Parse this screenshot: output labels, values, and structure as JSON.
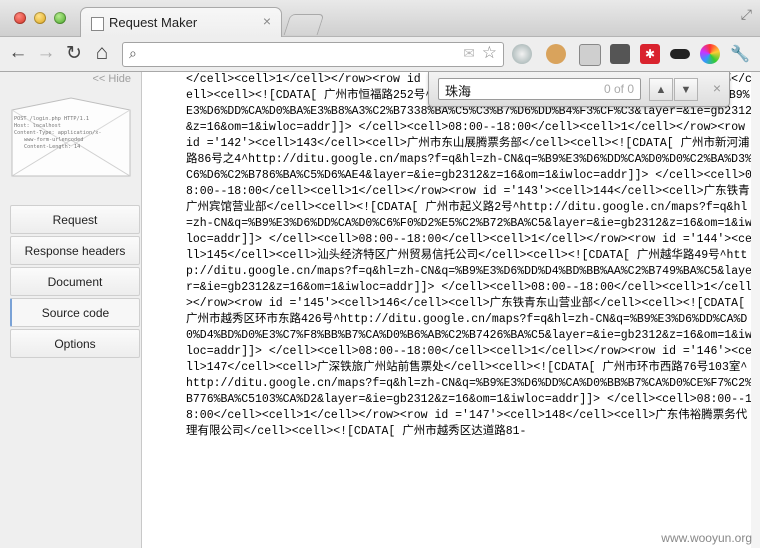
{
  "window": {
    "tab_title": "Request Maker",
    "tab_close": "×"
  },
  "toolbar": {
    "back_icon": "←",
    "forward_icon": "→",
    "reload_icon": "↻",
    "home_icon": "⌂",
    "search_icon": "⌕",
    "star_icon": "☆"
  },
  "find": {
    "query": "珠海",
    "count": "0 of 0",
    "prev": "▲",
    "next": "▼",
    "close": "×"
  },
  "sidebar": {
    "hide_label": "<< Hide",
    "envelope_text": [
      "POST /login.php HTTP/1.1",
      "Host: localhost",
      "Content-Type: application/x-",
      "www-form-urlencoded",
      "Content-Length: 14"
    ],
    "items": [
      {
        "label": "Request"
      },
      {
        "label": "Response headers"
      },
      {
        "label": "Document"
      },
      {
        "label": "Source code",
        "active": true
      },
      {
        "label": "Options"
      }
    ]
  },
  "source": {
    "text": "</cell><cell>1</cell></row><row id ='141'><cell>142</cell><cell>广州东方宾馆营业部</cell><cell><![CDATA[ 广州市恒福路252号^http://ditu.google.cn/maps?f=q&hl=zh-CN&q=%B9%E3%D6%DD%CA%D0%BA%E3%B8%A3%C2%B7338%BA%C5%C3%B7%D6%DD%B4%F3%CF%C3&layer=&ie=gb2312&z=16&om=1&iwloc=addr]]> </cell><cell>08:00--18:00</cell><cell>1</cell></row><row id ='142'><cell>143</cell><cell>广州市东山展腾票务部</cell><cell><![CDATA[ 广州市新河浦路86号之4^http://ditu.google.cn/maps?f=q&hl=zh-CN&q=%B9%E3%D6%DD%CA%D0%D0%C2%BA%D3%C6%D6%C2%B786%BA%C5%D6%AE4&layer=&ie=gb2312&z=16&om=1&iwloc=addr]]> </cell><cell>08:00--18:00</cell><cell>1</cell></row><row id ='143'><cell>144</cell><cell>广东铁青广州宾馆营业部</cell><cell><![CDATA[ 广州市起义路2号^http://ditu.google.cn/maps?f=q&hl=zh-CN&q=%B9%E3%D6%DD%CA%D0%C6%F0%D2%E5%C2%B72%BA%C5&layer=&ie=gb2312&z=16&om=1&iwloc=addr]]> </cell><cell>08:00--18:00</cell><cell>1</cell></row><row id ='144'><cell>145</cell><cell>汕头经济特区广州贸易信托公司</cell><cell><![CDATA[ 广州越华路49号^http://ditu.google.cn/maps?f=q&hl=zh-CN&q=%B9%E3%D6%DD%D4%BD%BB%AA%C2%B749%BA%C5&layer=&ie=gb2312&z=16&om=1&iwloc=addr]]> </cell><cell>08:00--18:00</cell><cell>1</cell></row><row id ='145'><cell>146</cell><cell>广东铁青东山营业部</cell><cell><![CDATA[ 广州市越秀区环市东路426号^http://ditu.google.cn/maps?f=q&hl=zh-CN&q=%B9%E3%D6%DD%CA%D0%D4%BD%D0%E3%C7%F8%BB%B7%CA%D0%B6%AB%C2%B7426%BA%C5&layer=&ie=gb2312&z=16&om=1&iwloc=addr]]> </cell><cell>08:00--18:00</cell><cell>1</cell></row><row id ='146'><cell>147</cell><cell>广深铁旅广州站前售票处</cell><cell><![CDATA[ 广州市环市西路76号103室^http://ditu.google.cn/maps?f=q&hl=zh-CN&q=%B9%E3%D6%DD%CA%D0%BB%B7%CA%D0%CE%F7%C2%B776%BA%C5103%CA%D2&layer=&ie=gb2312&z=16&om=1&iwloc=addr]]> </cell><cell>08:00--18:00</cell><cell>1</cell></row><row id ='147'><cell>148</cell><cell>广东伟裕腾票务代理有限公司</cell><cell><![CDATA[ 广州市越秀区达道路81-"
  },
  "watermark": "www.wooyun.org"
}
